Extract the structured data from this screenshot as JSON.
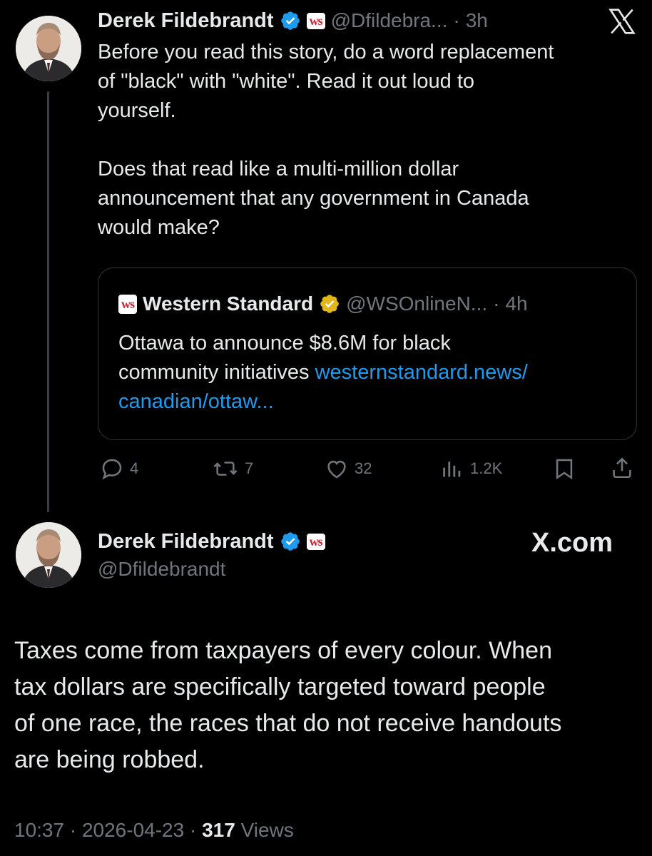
{
  "tweet1": {
    "author_name": "Derek Fildebrandt",
    "handle": "@Dfildebra...",
    "time": "3h",
    "separator": "·",
    "badge": "ws",
    "body_lines": [
      "Before you read this story, do a word replacement",
      "of \"black\" with \"white\". Read it out loud to",
      "yourself.",
      "",
      "Does that read like a multi-million dollar",
      "announcement that any government in Canada",
      "would make?"
    ],
    "quote": {
      "logo": "ws",
      "name": "Western Standard",
      "handle": "@WSOnlineN...",
      "separator": "·",
      "time": "4h",
      "text_line1": "Ottawa to announce $8.6M for black",
      "text_line2_prefix": "community initiatives ",
      "link_line1": "westernstandard.news/",
      "link_line2": "canadian/ottaw..."
    },
    "actions": {
      "replies": "4",
      "reposts": "7",
      "likes": "32",
      "views": "1.2K"
    }
  },
  "tweet2": {
    "author_name": "Derek Fildebrandt",
    "handle": "@Dfildebrandt",
    "badge": "ws",
    "body_lines": [
      "Taxes come from taxpayers of every colour. When",
      "tax dollars are specifically targeted toward people",
      "of one race, the races that do not receive handouts",
      "are being robbed."
    ],
    "time": "10:37",
    "date": "2026-04-23",
    "views_count": "317",
    "views_label": "Views",
    "sep": "·"
  },
  "branding": {
    "x_logo": "X",
    "x_com": "X.com"
  },
  "colors": {
    "background": "#000000",
    "text": "#e7e9ea",
    "muted": "#71767b",
    "link": "#1d9bf0",
    "verified_blue": "#1d9bf0",
    "verified_gold": "#e2b719",
    "ws_red": "#d0202e"
  },
  "icons": [
    "verified-badge-icon",
    "gold-verified-badge-icon",
    "reply-icon",
    "repost-icon",
    "like-icon",
    "views-icon",
    "bookmark-icon",
    "share-icon",
    "x-logo-icon"
  ]
}
